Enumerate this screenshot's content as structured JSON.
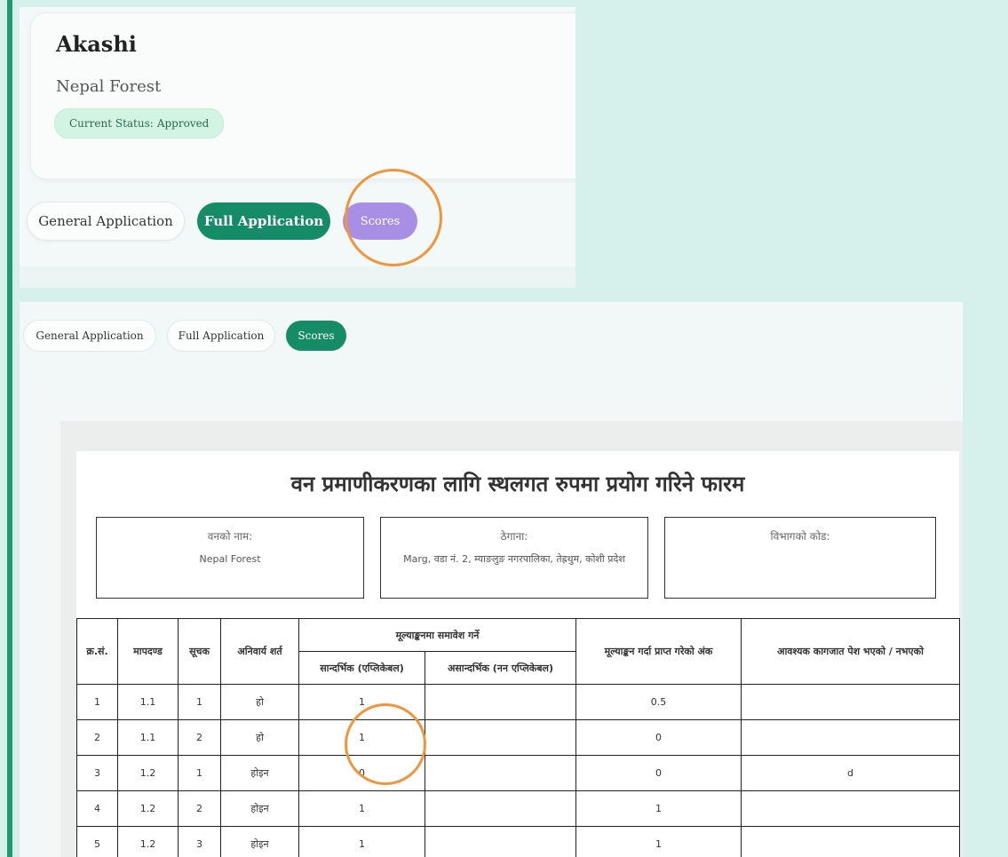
{
  "panel1": {
    "applicant_name": "Akashi",
    "forest_name": "Nepal Forest",
    "status_label": "Current Status:",
    "status_value": "Approved",
    "tabs": {
      "general": "General Application",
      "full": "Full Application",
      "scores": "Scores"
    }
  },
  "panel2": {
    "tabs": {
      "general": "General Application",
      "full": "Full Application",
      "scores": "Scores"
    },
    "form": {
      "title": "वन प्रमाणीकरणका लागि स्थलगत रुपमा प्रयोग गरिने फारम",
      "forest_name_label": "वनको नाम:",
      "forest_name_value": "Nepal Forest",
      "address_label": "ठेगाना:",
      "address_value": "Marg, वडा नं. 2, म्याङलुङ नगरपालिका, तेह्रथुम, कोशी प्रदेश",
      "dept_code_label": "विभागको कोड:",
      "dept_code_value": ""
    },
    "table": {
      "headers": {
        "sn": "क्र.सं.",
        "criteria": "मापदण्ड",
        "indicator": "सूचक",
        "mandatory": "अनिवार्य शर्त",
        "include_group": "मूल्याङ्कनमा समावेश गर्ने",
        "applicable": "सान्दर्भिक (एप्लिकेबल)",
        "not_applicable": "असान्दर्भिक (नन एप्लिकेबल)",
        "score": "मूल्याङ्कन गर्दा प्राप्त गरेको अंक",
        "docs": "आवश्यक कागजात पेश भएको / नभएको"
      },
      "rows": [
        {
          "sn": "1",
          "criteria": "1.1",
          "indicator": "1",
          "mandatory": "हो",
          "applicable": "1",
          "not_applicable": "",
          "score": "0.5",
          "docs": ""
        },
        {
          "sn": "2",
          "criteria": "1.1",
          "indicator": "2",
          "mandatory": "हो",
          "applicable": "1",
          "not_applicable": "",
          "score": "0",
          "docs": ""
        },
        {
          "sn": "3",
          "criteria": "1.2",
          "indicator": "1",
          "mandatory": "होइन",
          "applicable": "0",
          "not_applicable": "",
          "score": "0",
          "docs": "d"
        },
        {
          "sn": "4",
          "criteria": "1.2",
          "indicator": "2",
          "mandatory": "होइन",
          "applicable": "1",
          "not_applicable": "",
          "score": "1",
          "docs": ""
        },
        {
          "sn": "5",
          "criteria": "1.2",
          "indicator": "3",
          "mandatory": "होइन",
          "applicable": "1",
          "not_applicable": "",
          "score": "1",
          "docs": ""
        }
      ]
    }
  },
  "colors": {
    "background": "#d6f1eb",
    "accent_green": "#168c66",
    "scores_purple": "#a98ee6",
    "highlight_orange": "#f1943a",
    "status_pill": "#d3f3e3"
  }
}
